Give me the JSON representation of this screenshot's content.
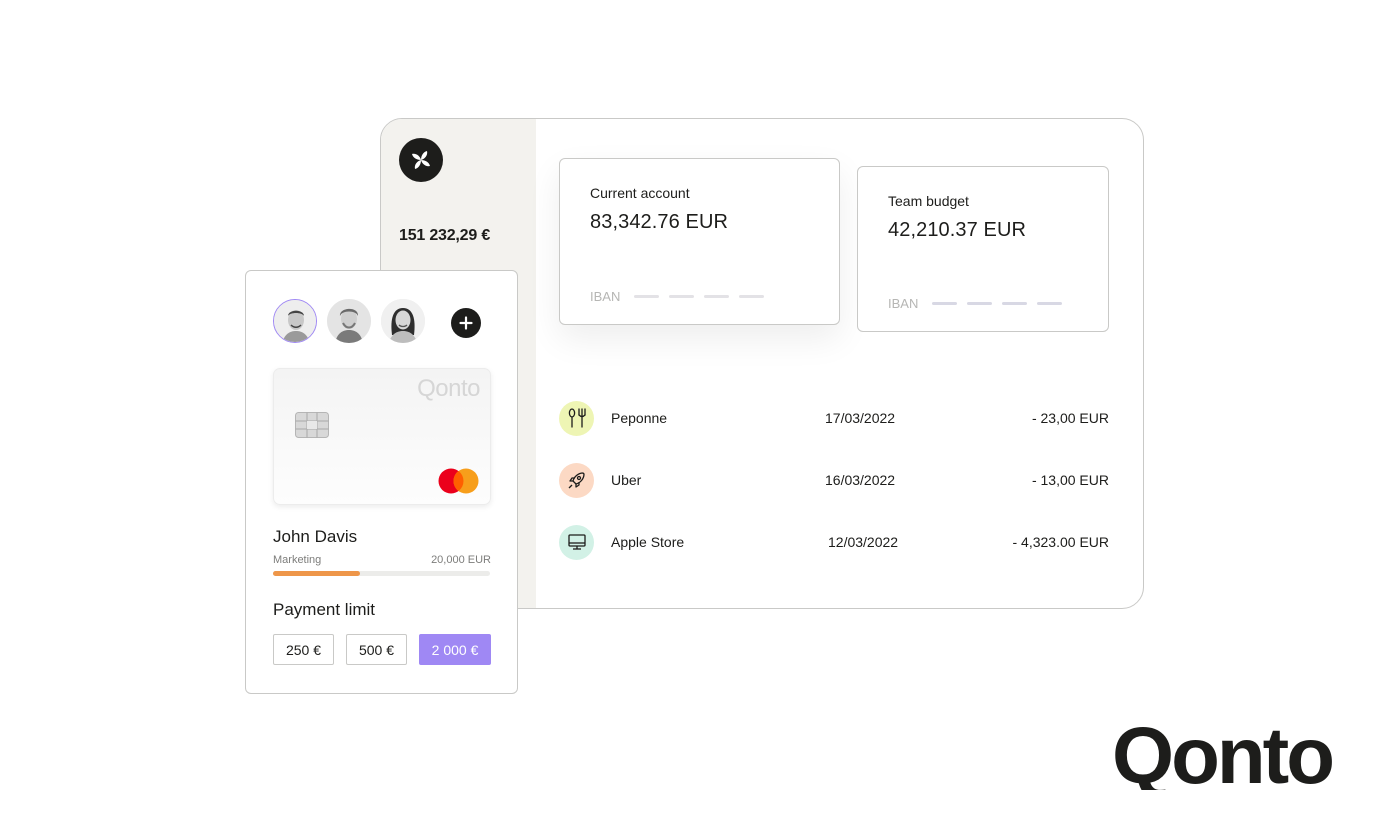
{
  "sidebar": {
    "total_balance": "151 232,29 €"
  },
  "accounts": [
    {
      "label": "Current account",
      "amount": "83,342.76 EUR",
      "iban_label": "IBAN"
    },
    {
      "label": "Team budget",
      "amount": "42,210.37 EUR",
      "iban_label": "IBAN"
    }
  ],
  "transactions": [
    {
      "name": "Peponne",
      "date": "17/03/2022",
      "amount": "- 23,00 EUR",
      "icon": "fork-knife-icon",
      "icon_bg": "#eef5b4"
    },
    {
      "name": "Uber",
      "date": "16/03/2022",
      "amount": "- 13,00 EUR",
      "icon": "rocket-icon",
      "icon_bg": "#fcd9c4"
    },
    {
      "name": "Apple Store",
      "date": "12/03/2022",
      "amount": "-  4,323.00 EUR",
      "icon": "monitor-icon",
      "icon_bg": "#d2f1e6"
    }
  ],
  "card_panel": {
    "card_brand": "Qonto",
    "holder_name": "John Davis",
    "holder_team": "Marketing",
    "holder_limit": "20,000 EUR",
    "spend_fraction": 0.4,
    "payment_limit_title": "Payment limit",
    "limit_options": [
      {
        "label": "250 €",
        "selected": false
      },
      {
        "label": "500 €",
        "selected": false
      },
      {
        "label": "2 000 €",
        "selected": true
      }
    ]
  },
  "brand": {
    "wordmark": "Qonto"
  },
  "colors": {
    "accent_purple": "#9f88f4",
    "progress_orange": "#ee9649",
    "dark": "#1d1d1b"
  }
}
